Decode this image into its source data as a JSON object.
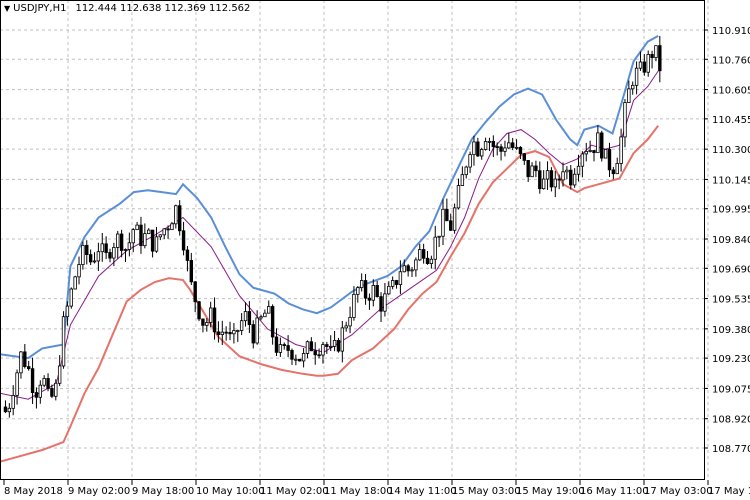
{
  "header": {
    "symbol_timeframe": "USDJPY,H1",
    "ohlc": "112.444 112.638 112.369 112.562"
  },
  "colors": {
    "background": "#ffffff",
    "grid": "#c0c0c0",
    "candles": "#000000",
    "upper_band": "#5a8fd8",
    "lower_band": "#e5736a",
    "middle_line": "#8b1a8b"
  },
  "chart_data": {
    "type": "candlestick",
    "y_axis": {
      "ticks": [
        "110.910",
        "110.760",
        "110.605",
        "110.455",
        "110.300",
        "110.145",
        "109.995",
        "109.840",
        "109.690",
        "109.535",
        "109.380",
        "109.230",
        "109.075",
        "108.920",
        "108.770"
      ],
      "range": [
        108.77,
        110.91
      ],
      "position": "right"
    },
    "x_axis": {
      "ticks": [
        "8 May 2018",
        "9 May 02:00",
        "9 May 18:00",
        "10 May 10:00",
        "11 May 02:00",
        "11 May 18:00",
        "14 May 11:00",
        "15 May 03:00",
        "15 May 19:00",
        "16 May 11:00",
        "17 May 03:00",
        "17 May 19:00"
      ]
    },
    "upper_band": [
      [
        0,
        109.25
      ],
      [
        0.02,
        109.24
      ],
      [
        0.04,
        109.23
      ],
      [
        0.06,
        109.28
      ],
      [
        0.09,
        109.3
      ],
      [
        0.1,
        109.7
      ],
      [
        0.12,
        109.85
      ],
      [
        0.14,
        109.95
      ],
      [
        0.17,
        110.02
      ],
      [
        0.19,
        110.08
      ],
      [
        0.21,
        110.09
      ],
      [
        0.23,
        110.08
      ],
      [
        0.25,
        110.07
      ],
      [
        0.26,
        110.12
      ],
      [
        0.28,
        110.05
      ],
      [
        0.3,
        109.95
      ],
      [
        0.32,
        109.8
      ],
      [
        0.34,
        109.66
      ],
      [
        0.36,
        109.59
      ],
      [
        0.39,
        109.56
      ],
      [
        0.41,
        109.51
      ],
      [
        0.43,
        109.48
      ],
      [
        0.45,
        109.46
      ],
      [
        0.47,
        109.49
      ],
      [
        0.5,
        109.57
      ],
      [
        0.52,
        109.61
      ],
      [
        0.55,
        109.65
      ],
      [
        0.57,
        109.7
      ],
      [
        0.59,
        109.8
      ],
      [
        0.61,
        109.88
      ],
      [
        0.63,
        110.05
      ],
      [
        0.65,
        110.2
      ],
      [
        0.67,
        110.35
      ],
      [
        0.69,
        110.44
      ],
      [
        0.71,
        110.52
      ],
      [
        0.73,
        110.58
      ],
      [
        0.75,
        110.61
      ],
      [
        0.77,
        110.58
      ],
      [
        0.79,
        110.45
      ],
      [
        0.81,
        110.35
      ],
      [
        0.82,
        110.32
      ],
      [
        0.83,
        110.4
      ],
      [
        0.85,
        110.42
      ],
      [
        0.87,
        110.38
      ],
      [
        0.88,
        110.5
      ],
      [
        0.9,
        110.75
      ],
      [
        0.92,
        110.85
      ],
      [
        0.935,
        110.88
      ]
    ],
    "lower_band": [
      [
        0,
        108.7
      ],
      [
        0.02,
        108.72
      ],
      [
        0.04,
        108.74
      ],
      [
        0.06,
        108.76
      ],
      [
        0.09,
        108.8
      ],
      [
        0.1,
        108.88
      ],
      [
        0.12,
        109.05
      ],
      [
        0.14,
        109.18
      ],
      [
        0.16,
        109.35
      ],
      [
        0.18,
        109.52
      ],
      [
        0.2,
        109.58
      ],
      [
        0.22,
        109.62
      ],
      [
        0.24,
        109.64
      ],
      [
        0.26,
        109.63
      ],
      [
        0.27,
        109.58
      ],
      [
        0.29,
        109.46
      ],
      [
        0.31,
        109.34
      ],
      [
        0.34,
        109.24
      ],
      [
        0.37,
        109.2
      ],
      [
        0.4,
        109.17
      ],
      [
        0.43,
        109.15
      ],
      [
        0.45,
        109.14
      ],
      [
        0.46,
        109.14
      ],
      [
        0.48,
        109.15
      ],
      [
        0.5,
        109.22
      ],
      [
        0.53,
        109.28
      ],
      [
        0.56,
        109.38
      ],
      [
        0.58,
        109.48
      ],
      [
        0.6,
        109.56
      ],
      [
        0.62,
        109.62
      ],
      [
        0.64,
        109.75
      ],
      [
        0.66,
        109.87
      ],
      [
        0.68,
        110.02
      ],
      [
        0.7,
        110.13
      ],
      [
        0.72,
        110.2
      ],
      [
        0.74,
        110.27
      ],
      [
        0.76,
        110.29
      ],
      [
        0.78,
        110.26
      ],
      [
        0.8,
        110.12
      ],
      [
        0.82,
        110.08
      ],
      [
        0.83,
        110.1
      ],
      [
        0.85,
        110.12
      ],
      [
        0.87,
        110.14
      ],
      [
        0.88,
        110.15
      ],
      [
        0.9,
        110.28
      ],
      [
        0.92,
        110.35
      ],
      [
        0.935,
        110.42
      ]
    ],
    "middle_line": [
      [
        0,
        109.05
      ],
      [
        0.04,
        109.02
      ],
      [
        0.08,
        109.1
      ],
      [
        0.1,
        109.4
      ],
      [
        0.14,
        109.65
      ],
      [
        0.18,
        109.78
      ],
      [
        0.22,
        109.86
      ],
      [
        0.26,
        109.95
      ],
      [
        0.3,
        109.8
      ],
      [
        0.34,
        109.55
      ],
      [
        0.38,
        109.38
      ],
      [
        0.42,
        109.3
      ],
      [
        0.46,
        109.26
      ],
      [
        0.5,
        109.35
      ],
      [
        0.54,
        109.48
      ],
      [
        0.58,
        109.58
      ],
      [
        0.62,
        109.68
      ],
      [
        0.64,
        109.8
      ],
      [
        0.66,
        109.95
      ],
      [
        0.68,
        110.15
      ],
      [
        0.7,
        110.3
      ],
      [
        0.72,
        110.38
      ],
      [
        0.74,
        110.4
      ],
      [
        0.76,
        110.35
      ],
      [
        0.78,
        110.28
      ],
      [
        0.8,
        110.22
      ],
      [
        0.82,
        110.25
      ],
      [
        0.84,
        110.32
      ],
      [
        0.86,
        110.3
      ],
      [
        0.88,
        110.32
      ],
      [
        0.9,
        110.55
      ],
      [
        0.92,
        110.62
      ],
      [
        0.935,
        110.7
      ]
    ],
    "candle_close_path": [
      [
        0,
        108.98
      ],
      [
        0.01,
        108.95
      ],
      [
        0.02,
        109.1
      ],
      [
        0.03,
        109.25
      ],
      [
        0.04,
        109.18
      ],
      [
        0.05,
        109.05
      ],
      [
        0.06,
        109.15
      ],
      [
        0.07,
        109.0
      ],
      [
        0.08,
        109.08
      ],
      [
        0.09,
        109.4
      ],
      [
        0.1,
        109.55
      ],
      [
        0.11,
        109.7
      ],
      [
        0.12,
        109.78
      ],
      [
        0.13,
        109.72
      ],
      [
        0.14,
        109.8
      ],
      [
        0.15,
        109.74
      ],
      [
        0.16,
        109.82
      ],
      [
        0.17,
        109.85
      ],
      [
        0.18,
        109.78
      ],
      [
        0.19,
        109.9
      ],
      [
        0.2,
        109.84
      ],
      [
        0.21,
        109.86
      ],
      [
        0.22,
        109.8
      ],
      [
        0.23,
        109.88
      ],
      [
        0.24,
        109.92
      ],
      [
        0.25,
        110.0
      ],
      [
        0.26,
        109.85
      ],
      [
        0.27,
        109.62
      ],
      [
        0.28,
        109.5
      ],
      [
        0.29,
        109.4
      ],
      [
        0.3,
        109.45
      ],
      [
        0.31,
        109.35
      ],
      [
        0.32,
        109.38
      ],
      [
        0.33,
        109.3
      ],
      [
        0.34,
        109.4
      ],
      [
        0.35,
        109.45
      ],
      [
        0.36,
        109.35
      ],
      [
        0.37,
        109.42
      ],
      [
        0.38,
        109.48
      ],
      [
        0.39,
        109.3
      ],
      [
        0.4,
        109.25
      ],
      [
        0.41,
        109.28
      ],
      [
        0.42,
        109.25
      ],
      [
        0.43,
        109.22
      ],
      [
        0.44,
        109.3
      ],
      [
        0.45,
        109.28
      ],
      [
        0.46,
        109.32
      ],
      [
        0.47,
        109.25
      ],
      [
        0.48,
        109.3
      ],
      [
        0.49,
        109.4
      ],
      [
        0.5,
        109.5
      ],
      [
        0.51,
        109.6
      ],
      [
        0.52,
        109.55
      ],
      [
        0.53,
        109.58
      ],
      [
        0.54,
        109.5
      ],
      [
        0.55,
        109.55
      ],
      [
        0.56,
        109.6
      ],
      [
        0.57,
        109.7
      ],
      [
        0.58,
        109.68
      ],
      [
        0.59,
        109.72
      ],
      [
        0.6,
        109.8
      ],
      [
        0.61,
        109.75
      ],
      [
        0.62,
        109.85
      ],
      [
        0.63,
        109.95
      ],
      [
        0.64,
        109.9
      ],
      [
        0.65,
        110.05
      ],
      [
        0.66,
        110.2
      ],
      [
        0.67,
        110.35
      ],
      [
        0.68,
        110.3
      ],
      [
        0.69,
        110.38
      ],
      [
        0.7,
        110.32
      ],
      [
        0.71,
        110.28
      ],
      [
        0.72,
        110.35
      ],
      [
        0.73,
        110.3
      ],
      [
        0.74,
        110.25
      ],
      [
        0.75,
        110.18
      ],
      [
        0.76,
        110.2
      ],
      [
        0.77,
        110.12
      ],
      [
        0.78,
        110.15
      ],
      [
        0.79,
        110.1
      ],
      [
        0.8,
        110.22
      ],
      [
        0.81,
        110.15
      ],
      [
        0.82,
        110.25
      ],
      [
        0.83,
        110.32
      ],
      [
        0.84,
        110.3
      ],
      [
        0.85,
        110.35
      ],
      [
        0.86,
        110.25
      ],
      [
        0.87,
        110.2
      ],
      [
        0.88,
        110.3
      ],
      [
        0.89,
        110.55
      ],
      [
        0.9,
        110.68
      ],
      [
        0.91,
        110.7
      ],
      [
        0.92,
        110.75
      ],
      [
        0.93,
        110.82
      ],
      [
        0.935,
        110.72
      ]
    ]
  }
}
